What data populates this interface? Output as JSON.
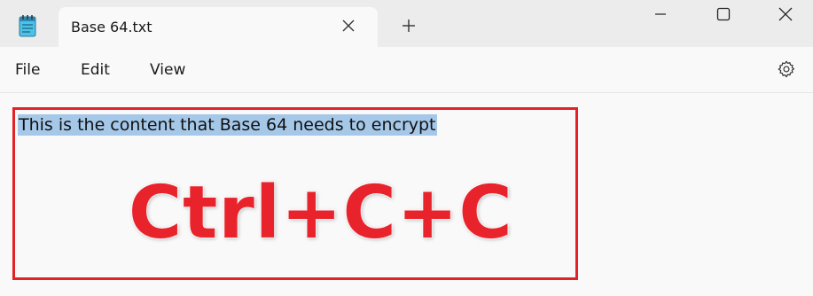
{
  "window": {
    "tab_title": "Base 64.txt",
    "new_tab_symbol": "+"
  },
  "menu": {
    "file": "File",
    "edit": "Edit",
    "view": "View"
  },
  "editor": {
    "content": "This is the content that Base 64 needs to encrypt"
  },
  "annotation": {
    "text": "Ctrl+C+C",
    "color": "#e8232b"
  },
  "icons": {
    "app": "notepad-icon",
    "tab_close": "close-icon",
    "new_tab": "plus-icon",
    "minimize": "minimize-icon",
    "maximize": "maximize-icon",
    "close": "close-icon",
    "settings": "gear-icon"
  },
  "colors": {
    "selection": "#a5c7e8",
    "highlight_border": "#e32228"
  }
}
